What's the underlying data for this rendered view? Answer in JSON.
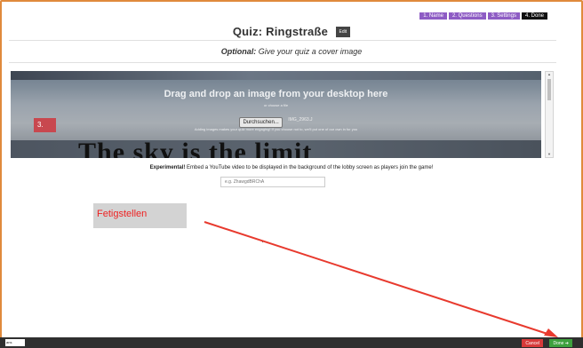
{
  "steps": [
    "1. Name",
    "2. Questions",
    "3. Settings",
    "4. Done"
  ],
  "title": "Quiz: Ringstraße",
  "edit_label": "Edit",
  "optional_prefix": "Optional:",
  "optional_text": "Give your quiz a cover image",
  "cover": {
    "drag_text": "Drag and drop an image from your desktop here",
    "choose_text": "or choose a file",
    "browse_button": "Durchsuchen...",
    "file_name": "IMG_2963.J",
    "hint": "Adding images makes your quiz more engaging! If you choose not to, we'll put one of our own in for you",
    "image_caption": "The sky is the limit",
    "step_annotation": "3."
  },
  "experimental": {
    "label": "Experimental!",
    "text": "Embed a YouTube video to be displayed in the background of the lobby screen as players join the game!",
    "placeholder": "e.g. ZhawgdBRChA"
  },
  "annotation_label": "Fetigstellen",
  "bottom": {
    "input_value": "ans",
    "cancel": "Cancel",
    "done": "Done ➔"
  },
  "colors": {
    "annotation_red": "#ee2222",
    "arrow_red": "#e83a2e",
    "step_purple": "#8e5cc4",
    "done_green": "#3ea13e",
    "cancel_red": "#d73a3a"
  }
}
